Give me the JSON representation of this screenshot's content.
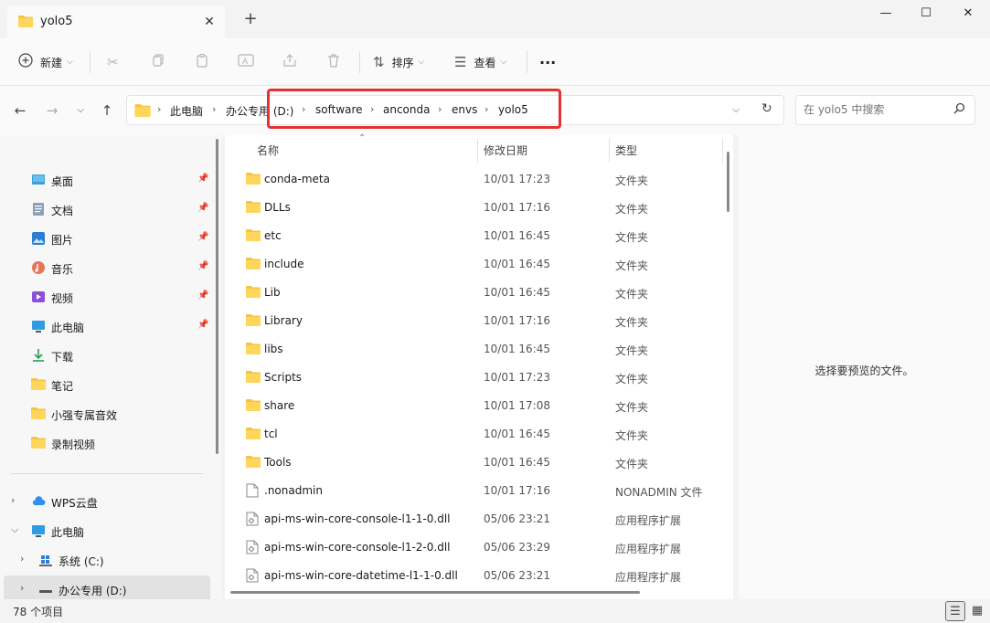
{
  "window": {
    "tab_title": "yolo5",
    "new_tab": "+",
    "minimize": "—",
    "maximize": "☐",
    "close": "✕"
  },
  "toolbar": {
    "new_label": "新建",
    "sort_label": "排序",
    "view_label": "查看",
    "more": "···"
  },
  "address": {
    "crumbs": [
      "此电脑",
      "办公专用 (D:)",
      "software",
      "anconda",
      "envs",
      "yolo5"
    ],
    "highlight_color": "#e5312f"
  },
  "search": {
    "placeholder": "在 yolo5 中搜索"
  },
  "sidebar": {
    "quick_access": [
      {
        "label": "桌面",
        "icon": "desktop-icon",
        "pinned": true
      },
      {
        "label": "文档",
        "icon": "documents-icon",
        "pinned": true
      },
      {
        "label": "图片",
        "icon": "pictures-icon",
        "pinned": true
      },
      {
        "label": "音乐",
        "icon": "music-icon",
        "pinned": true
      },
      {
        "label": "视频",
        "icon": "videos-icon",
        "pinned": true
      },
      {
        "label": "此电脑",
        "icon": "this-pc-icon",
        "pinned": true
      },
      {
        "label": "下载",
        "icon": "download-icon",
        "pinned": false
      },
      {
        "label": "笔记",
        "icon": "folder-icon",
        "pinned": false
      },
      {
        "label": "小强专属音效",
        "icon": "folder-icon",
        "pinned": false
      },
      {
        "label": "录制视频",
        "icon": "folder-icon",
        "pinned": false
      }
    ],
    "tree": [
      {
        "label": "WPS云盘",
        "icon": "cloud-icon"
      },
      {
        "label": "此电脑",
        "icon": "this-pc-icon"
      },
      {
        "label": "系统 (C:)",
        "icon": "windows-drive-icon"
      },
      {
        "label": "办公专用 (D:)",
        "icon": "drive-icon"
      }
    ]
  },
  "columns": {
    "name": "名称",
    "date": "修改日期",
    "type": "类型"
  },
  "files": [
    {
      "name": "conda-meta",
      "date": "10/01 17:23",
      "type": "文件夹",
      "kind": "folder"
    },
    {
      "name": "DLLs",
      "date": "10/01 17:16",
      "type": "文件夹",
      "kind": "folder"
    },
    {
      "name": "etc",
      "date": "10/01 16:45",
      "type": "文件夹",
      "kind": "folder"
    },
    {
      "name": "include",
      "date": "10/01 16:45",
      "type": "文件夹",
      "kind": "folder"
    },
    {
      "name": "Lib",
      "date": "10/01 16:45",
      "type": "文件夹",
      "kind": "folder"
    },
    {
      "name": "Library",
      "date": "10/01 17:16",
      "type": "文件夹",
      "kind": "folder"
    },
    {
      "name": "libs",
      "date": "10/01 16:45",
      "type": "文件夹",
      "kind": "folder"
    },
    {
      "name": "Scripts",
      "date": "10/01 17:23",
      "type": "文件夹",
      "kind": "folder"
    },
    {
      "name": "share",
      "date": "10/01 17:08",
      "type": "文件夹",
      "kind": "folder"
    },
    {
      "name": "tcl",
      "date": "10/01 16:45",
      "type": "文件夹",
      "kind": "folder"
    },
    {
      "name": "Tools",
      "date": "10/01 16:45",
      "type": "文件夹",
      "kind": "folder"
    },
    {
      "name": ".nonadmin",
      "date": "10/01 17:16",
      "type": "NONADMIN 文件",
      "kind": "file"
    },
    {
      "name": "api-ms-win-core-console-l1-1-0.dll",
      "date": "05/06 23:21",
      "type": "应用程序扩展",
      "kind": "dll"
    },
    {
      "name": "api-ms-win-core-console-l1-2-0.dll",
      "date": "05/06 23:29",
      "type": "应用程序扩展",
      "kind": "dll"
    },
    {
      "name": "api-ms-win-core-datetime-l1-1-0.dll",
      "date": "05/06 23:21",
      "type": "应用程序扩展",
      "kind": "dll"
    }
  ],
  "preview": {
    "message": "选择要预览的文件。"
  },
  "status": {
    "count": "78 个项目"
  }
}
